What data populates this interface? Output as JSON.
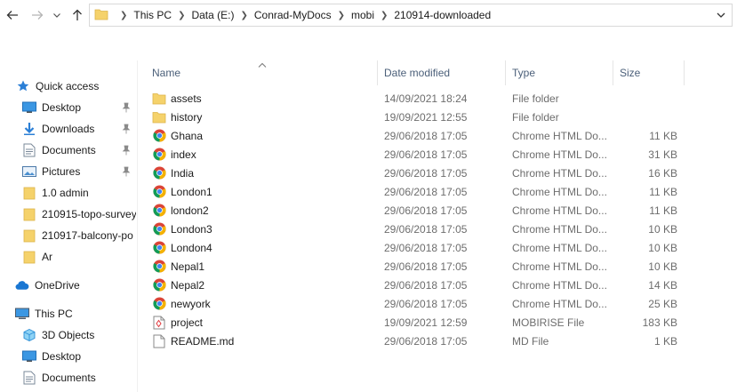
{
  "nav": {
    "back_icon": "arrow-left-icon",
    "forward_icon": "arrow-right-icon",
    "recent_icon": "chevron-down-icon",
    "up_icon": "arrow-up-icon"
  },
  "address": {
    "crumbs": [
      "This PC",
      "Data (E:)",
      "Conrad-MyDocs",
      "mobi",
      "210914-downloaded"
    ]
  },
  "sidebar": {
    "items": [
      {
        "label": "Quick access",
        "icon": "star-icon",
        "pinned": false
      },
      {
        "label": "Desktop",
        "icon": "desktop-icon",
        "pinned": true
      },
      {
        "label": "Downloads",
        "icon": "download-icon",
        "pinned": true
      },
      {
        "label": "Documents",
        "icon": "documents-icon",
        "pinned": true
      },
      {
        "label": "Pictures",
        "icon": "pictures-icon",
        "pinned": true
      },
      {
        "label": "1.0 admin",
        "icon": "folder-icon",
        "pinned": false
      },
      {
        "label": "210915-topo-survey",
        "icon": "folder-icon",
        "pinned": false
      },
      {
        "label": "210917-balcony-po",
        "icon": "folder-icon",
        "pinned": false
      },
      {
        "label": "Ar",
        "icon": "folder-icon",
        "pinned": false
      },
      {
        "label": "OneDrive",
        "icon": "cloud-icon",
        "pinned": false
      },
      {
        "label": "This PC",
        "icon": "computer-icon",
        "pinned": false
      },
      {
        "label": "3D Objects",
        "icon": "3d-objects-icon",
        "pinned": false
      },
      {
        "label": "Desktop",
        "icon": "desktop-icon",
        "pinned": false
      },
      {
        "label": "Documents",
        "icon": "documents-icon",
        "pinned": false
      }
    ]
  },
  "columns": {
    "name": "Name",
    "date": "Date modified",
    "type": "Type",
    "size": "Size"
  },
  "files": [
    {
      "name": "assets",
      "date": "14/09/2021 18:24",
      "type": "File folder",
      "size": "",
      "icon": "folder-icon"
    },
    {
      "name": "history",
      "date": "19/09/2021 12:55",
      "type": "File folder",
      "size": "",
      "icon": "folder-icon"
    },
    {
      "name": "Ghana",
      "date": "29/06/2018 17:05",
      "type": "Chrome HTML Do...",
      "size": "11 KB",
      "icon": "chrome-icon"
    },
    {
      "name": "index",
      "date": "29/06/2018 17:05",
      "type": "Chrome HTML Do...",
      "size": "31 KB",
      "icon": "chrome-icon"
    },
    {
      "name": "India",
      "date": "29/06/2018 17:05",
      "type": "Chrome HTML Do...",
      "size": "16 KB",
      "icon": "chrome-icon"
    },
    {
      "name": "London1",
      "date": "29/06/2018 17:05",
      "type": "Chrome HTML Do...",
      "size": "11 KB",
      "icon": "chrome-icon"
    },
    {
      "name": "london2",
      "date": "29/06/2018 17:05",
      "type": "Chrome HTML Do...",
      "size": "11 KB",
      "icon": "chrome-icon"
    },
    {
      "name": "London3",
      "date": "29/06/2018 17:05",
      "type": "Chrome HTML Do...",
      "size": "10 KB",
      "icon": "chrome-icon"
    },
    {
      "name": "London4",
      "date": "29/06/2018 17:05",
      "type": "Chrome HTML Do...",
      "size": "10 KB",
      "icon": "chrome-icon"
    },
    {
      "name": "Nepal1",
      "date": "29/06/2018 17:05",
      "type": "Chrome HTML Do...",
      "size": "10 KB",
      "icon": "chrome-icon"
    },
    {
      "name": "Nepal2",
      "date": "29/06/2018 17:05",
      "type": "Chrome HTML Do...",
      "size": "14 KB",
      "icon": "chrome-icon"
    },
    {
      "name": "newyork",
      "date": "29/06/2018 17:05",
      "type": "Chrome HTML Do...",
      "size": "25 KB",
      "icon": "chrome-icon"
    },
    {
      "name": "project",
      "date": "19/09/2021 12:59",
      "type": "MOBIRISE File",
      "size": "183 KB",
      "icon": "mobirise-file-icon"
    },
    {
      "name": "README.md",
      "date": "29/06/2018 17:05",
      "type": "MD File",
      "size": "1 KB",
      "icon": "text-file-icon"
    }
  ],
  "colors": {
    "folder": "#f5d26b",
    "accent": "#1e88e5",
    "header_text": "#4c607a"
  }
}
